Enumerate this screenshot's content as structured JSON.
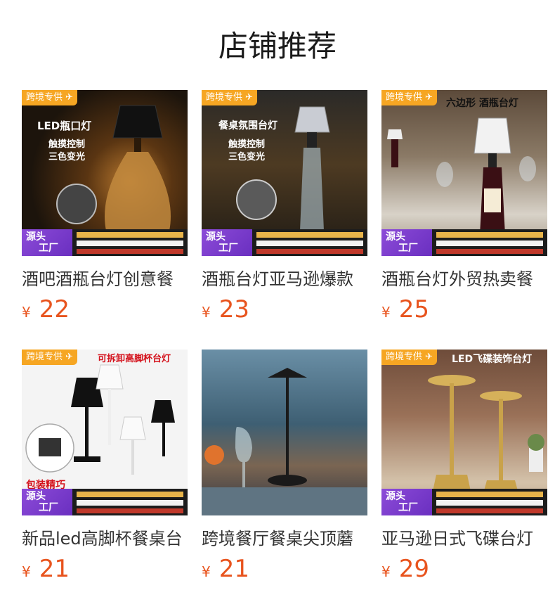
{
  "section_title": "店铺推荐",
  "overlay": {
    "cross_border": "跨境专供",
    "source": "源头",
    "factory": "工厂"
  },
  "colors": {
    "price": "#e8541e",
    "tag": "#f6a623",
    "badge": "#7a3ccf"
  },
  "products": [
    {
      "name": "酒吧酒瓶台灯创意餐",
      "currency": "¥",
      "price": "22",
      "image_text": [
        "LED瓶口灯",
        "触摸控制",
        "三色变光"
      ]
    },
    {
      "name": "酒瓶台灯亚马逊爆款",
      "currency": "¥",
      "price": "23",
      "image_text": [
        "餐桌氛围台灯",
        "触摸控制",
        "三色变光"
      ]
    },
    {
      "name": "酒瓶台灯外贸热卖餐",
      "currency": "¥",
      "price": "25",
      "image_text": [
        "六边形 酒瓶台灯"
      ]
    },
    {
      "name": "新品led高脚杯餐桌台",
      "currency": "¥",
      "price": "21",
      "image_text": [
        "可拆卸高脚杯台灯",
        "包装精巧"
      ]
    },
    {
      "name": "跨境餐厅餐桌尖顶蘑",
      "currency": "¥",
      "price": "21",
      "image_text": []
    },
    {
      "name": "亚马逊日式飞碟台灯",
      "currency": "¥",
      "price": "29",
      "image_text": [
        "LED飞碟装饰台灯"
      ]
    }
  ]
}
